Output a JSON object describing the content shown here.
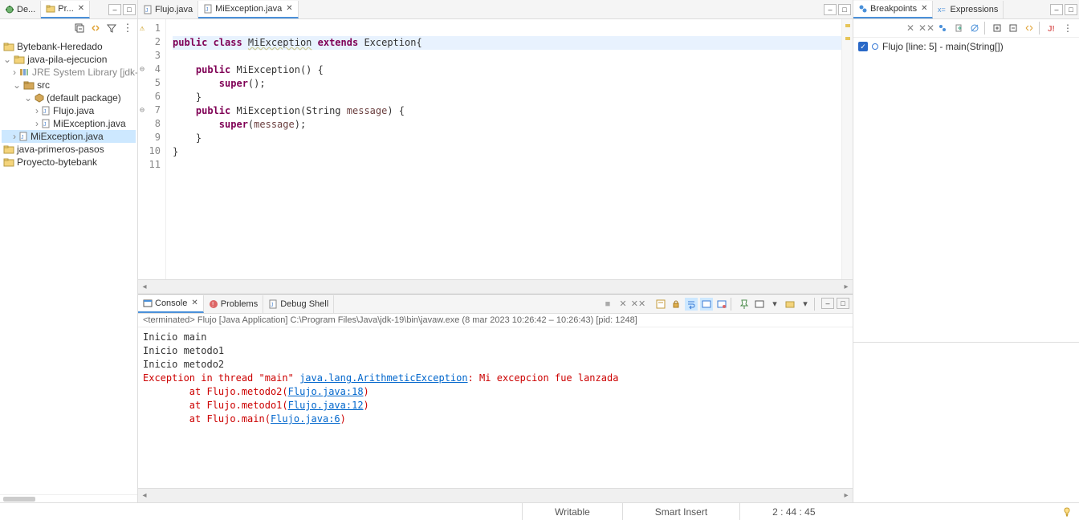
{
  "leftTabs": {
    "debug": "De...",
    "project": "Pr..."
  },
  "projectTree": {
    "p1": "Bytebank-Heredado",
    "p2": "java-pila-ejecucion",
    "p2_lib": "JRE System Library [jdk-",
    "p2_src": "src",
    "p2_pkg": "(default package)",
    "p2_f1": "Flujo.java",
    "p2_f2": "MiException.java",
    "p2_sel": "MiException.java",
    "p3": "java-primeros-pasos",
    "p4": "Proyecto-bytebank"
  },
  "editorTabs": {
    "t1": "Flujo.java",
    "t2": "MiException.java"
  },
  "code": {
    "l1": "",
    "l2_pre": "public class ",
    "l2_name": "MiException",
    "l2_mid": " extends ",
    "l2_sup": "Exception",
    "l2_end": "{",
    "l3": "",
    "l4": "    public MiException() {",
    "l5": "        super();",
    "l6": "    }",
    "l7": "    public MiException(String ",
    "l7_p": "message",
    "l7_e": ") {",
    "l8": "        super(",
    "l8_p": "message",
    "l8_e": ");",
    "l9": "    }",
    "l10": "}",
    "l11": ""
  },
  "lineNumbers": [
    "1",
    "2",
    "3",
    "4",
    "5",
    "6",
    "7",
    "8",
    "9",
    "10",
    "11"
  ],
  "bottomTabs": {
    "console": "Console",
    "problems": "Problems",
    "debugShell": "Debug Shell"
  },
  "consoleStatus": "<terminated> Flujo [Java Application] C:\\Program Files\\Java\\jdk-19\\bin\\javaw.exe (8 mar 2023 10:26:42 – 10:26:43) [pid: 1248]",
  "console": {
    "l1": "Inicio main",
    "l2": "Inicio metodo1",
    "l3": "Inicio metodo2",
    "l4a": "Exception in thread \"main\" ",
    "l4b": "java.lang.ArithmeticException",
    "l4c": ": Mi excepcion fue lanzada",
    "l5a": "        at Flujo.metodo2(",
    "l5b": "Flujo.java:18",
    "l5c": ")",
    "l6a": "        at Flujo.metodo1(",
    "l6b": "Flujo.java:12",
    "l6c": ")",
    "l7a": "        at Flujo.main(",
    "l7b": "Flujo.java:6",
    "l7c": ")"
  },
  "rightTabs": {
    "breakpoints": "Breakpoints",
    "expressions": "Expressions"
  },
  "breakpoints": {
    "item1": "Flujo [line: 5] - main(String[])"
  },
  "statusBar": {
    "writable": "Writable",
    "insert": "Smart Insert",
    "pos": "2 : 44 : 45"
  }
}
